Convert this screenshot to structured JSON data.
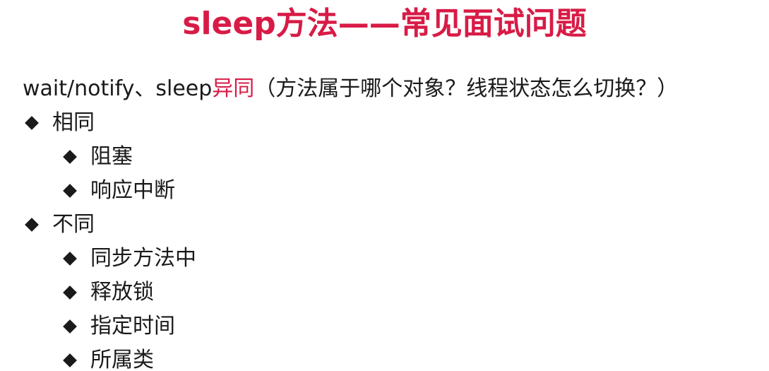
{
  "title": "sleep方法——常见面试问题",
  "question": {
    "prefix": "wait/notify、sleep",
    "highlight": "异同",
    "suffix": "（方法属于哪个对象？线程状态怎么切换？）"
  },
  "sections": [
    {
      "label": "相同",
      "items": [
        "阻塞",
        "响应中断"
      ]
    },
    {
      "label": "不同",
      "items": [
        "同步方法中",
        "释放锁",
        "指定时间",
        "所属类"
      ]
    }
  ],
  "colors": {
    "accent": "#d81b46",
    "text": "#1a1a1a"
  },
  "icons": {
    "bullet": "diamond-bullet-icon"
  }
}
